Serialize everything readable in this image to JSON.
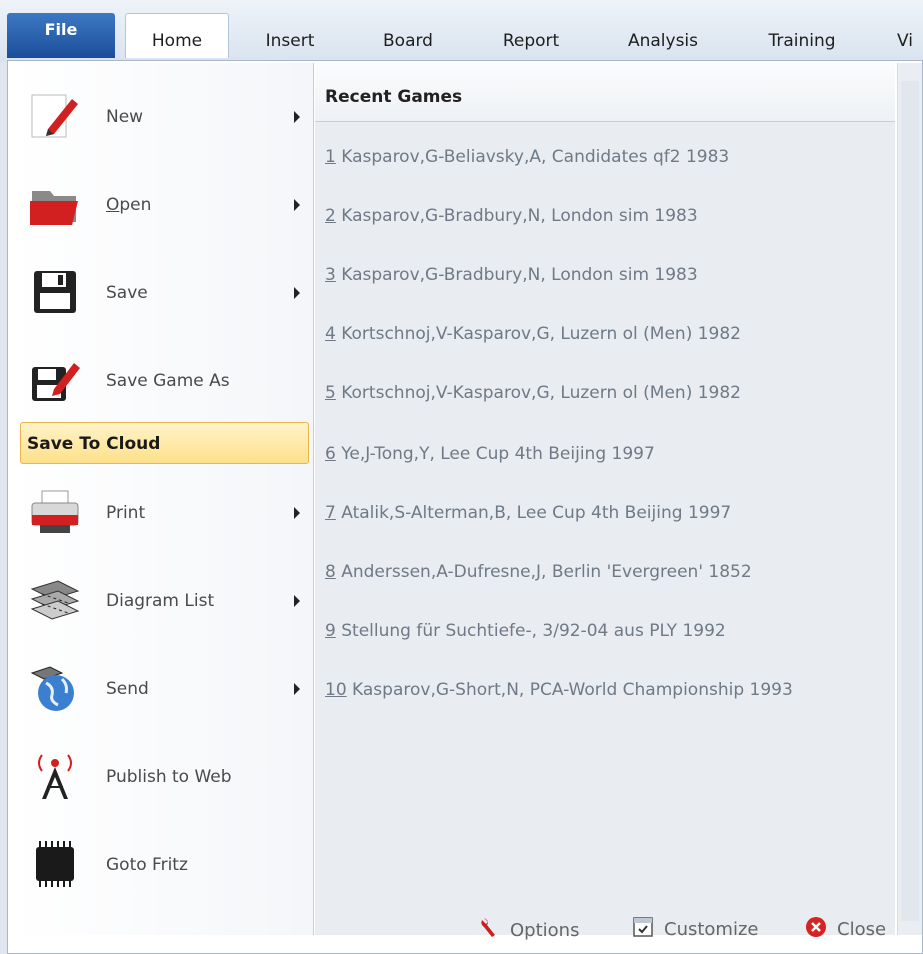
{
  "ribbon": {
    "file_label": "File",
    "tabs": [
      "Home",
      "Insert",
      "Board",
      "Report",
      "Analysis",
      "Training",
      "Vi"
    ]
  },
  "menu": {
    "items": [
      {
        "label": "New",
        "icon": "pencil-icon",
        "has_submenu": true
      },
      {
        "label": "Open",
        "icon": "folder-icon",
        "has_submenu": true
      },
      {
        "label": "Save",
        "icon": "floppy-disk-icon",
        "has_submenu": true
      },
      {
        "label": "Save Game As",
        "icon": "floppy-pencil-icon",
        "has_submenu": false
      },
      {
        "label": "Save To Cloud",
        "highlighted": true
      },
      {
        "label": "Print",
        "icon": "printer-icon",
        "has_submenu": true
      },
      {
        "label": "Diagram List",
        "icon": "chessboards-icon",
        "has_submenu": true
      },
      {
        "label": "Send",
        "icon": "globe-icon",
        "has_submenu": true
      },
      {
        "label": "Publish to Web",
        "icon": "broadcast-tower-icon",
        "has_submenu": false
      },
      {
        "label": "Goto Fritz",
        "icon": "chip-icon",
        "has_submenu": false
      }
    ]
  },
  "recent": {
    "title": "Recent Games",
    "games": [
      {
        "num": "1",
        "text": " Kasparov,G-Beliavsky,A, Candidates qf2 1983"
      },
      {
        "num": "2",
        "text": " Kasparov,G-Bradbury,N, London sim 1983"
      },
      {
        "num": "3",
        "text": " Kasparov,G-Bradbury,N, London sim 1983"
      },
      {
        "num": "4",
        "text": " Kortschnoj,V-Kasparov,G, Luzern ol (Men) 1982"
      },
      {
        "num": "5",
        "text": " Kortschnoj,V-Kasparov,G, Luzern ol (Men) 1982"
      },
      {
        "num": "6",
        "text": " Ye,J-Tong,Y, Lee Cup 4th Beijing 1997"
      },
      {
        "num": "7",
        "text": " Atalik,S-Alterman,B, Lee Cup 4th Beijing 1997"
      },
      {
        "num": "8",
        "text": " Anderssen,A-Dufresne,J, Berlin 'Evergreen' 1852"
      },
      {
        "num": "9",
        "text": " Stellung für Suchtiefe-, 3/92-04 aus PLY 1992"
      },
      {
        "num": "10",
        "text": " Kasparov,G-Short,N, PCA-World Championship 1993"
      }
    ]
  },
  "footer": {
    "options_label": "Options",
    "customize_label": "Customize",
    "close_label": "Close"
  }
}
